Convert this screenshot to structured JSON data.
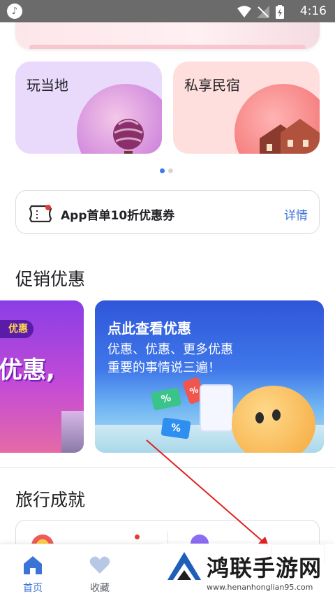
{
  "status_bar": {
    "time": "4:16",
    "app_icon": "music-note-icon"
  },
  "categories": [
    {
      "label": "玩当地",
      "icon": "hot-air-balloon-icon",
      "color": "#e9d9fb"
    },
    {
      "label": "私享民宿",
      "icon": "house-icon",
      "color": "#ffdede"
    }
  ],
  "carousel": {
    "pages": 2,
    "active": 1
  },
  "coupon": {
    "text": "App首单10折优惠券",
    "link": "详情",
    "icon": "ticket-icon"
  },
  "promotions": {
    "title": "促销优惠",
    "left_banner": {
      "badge": "优惠",
      "headline": "优惠,"
    },
    "main_banner": {
      "title": "点此查看优惠",
      "line1": "优惠、优惠、更多优惠",
      "line2": "重要的事情说三遍！",
      "tags": [
        "%",
        "%",
        "%"
      ]
    }
  },
  "achievements": {
    "title": "旅行成就"
  },
  "bottom_nav": [
    {
      "label": "首页",
      "icon": "home-icon",
      "active": true
    },
    {
      "label": "收藏",
      "icon": "heart-icon",
      "active": false
    }
  ],
  "watermark": {
    "title": "鸿联手游网",
    "url": "www.henanhonglian95.com"
  },
  "colors": {
    "accent": "#3b73d6",
    "annotation": "#e02020"
  }
}
